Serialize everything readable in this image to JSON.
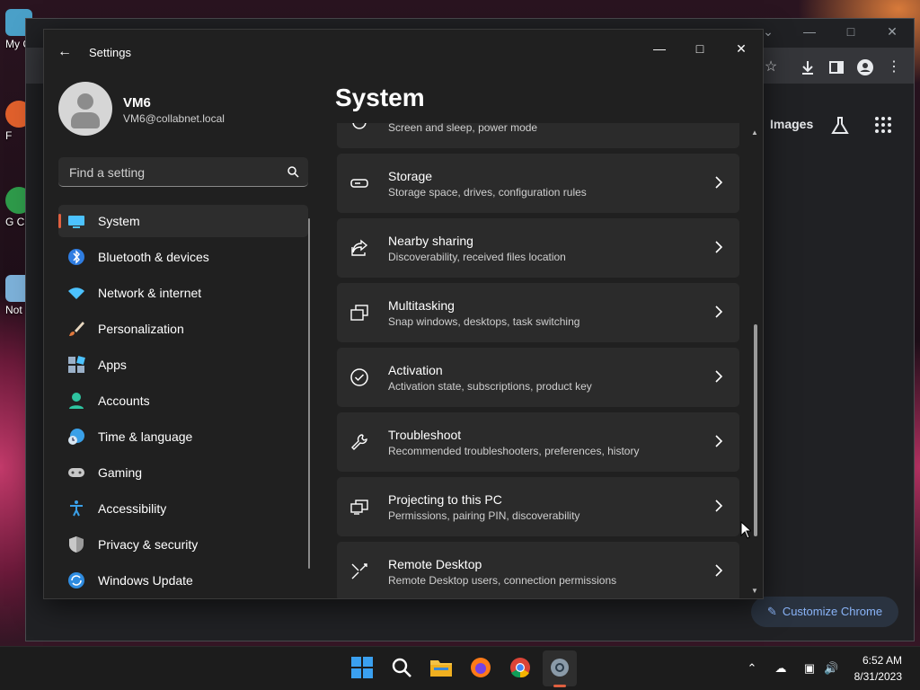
{
  "desktop": {
    "icons": [
      {
        "label": "My C"
      },
      {
        "label": "F"
      },
      {
        "label": "G Cl"
      },
      {
        "label": "Not"
      }
    ]
  },
  "chrome": {
    "images_label": "Images",
    "customize_label": "Customize Chrome"
  },
  "settings": {
    "window_title": "Settings",
    "user": {
      "name": "VM6",
      "email": "VM6@collabnet.local"
    },
    "search": {
      "placeholder": "Find a setting"
    },
    "nav": [
      {
        "label": "System",
        "icon": "system-icon",
        "active": true
      },
      {
        "label": "Bluetooth & devices",
        "icon": "bluetooth-icon"
      },
      {
        "label": "Network & internet",
        "icon": "wifi-icon"
      },
      {
        "label": "Personalization",
        "icon": "brush-icon"
      },
      {
        "label": "Apps",
        "icon": "apps-icon"
      },
      {
        "label": "Accounts",
        "icon": "account-icon"
      },
      {
        "label": "Time & language",
        "icon": "globe-clock-icon"
      },
      {
        "label": "Gaming",
        "icon": "gamepad-icon"
      },
      {
        "label": "Accessibility",
        "icon": "accessibility-icon"
      },
      {
        "label": "Privacy & security",
        "icon": "shield-icon"
      },
      {
        "label": "Windows Update",
        "icon": "update-icon"
      }
    ],
    "page_title": "System",
    "cards": [
      {
        "title": "",
        "subtitle": "Screen and sleep, power mode",
        "icon": "power-icon"
      },
      {
        "title": "Storage",
        "subtitle": "Storage space, drives, configuration rules",
        "icon": "storage-icon"
      },
      {
        "title": "Nearby sharing",
        "subtitle": "Discoverability, received files location",
        "icon": "share-icon"
      },
      {
        "title": "Multitasking",
        "subtitle": "Snap windows, desktops, task switching",
        "icon": "multitask-icon"
      },
      {
        "title": "Activation",
        "subtitle": "Activation state, subscriptions, product key",
        "icon": "check-circle-icon"
      },
      {
        "title": "Troubleshoot",
        "subtitle": "Recommended troubleshooters, preferences, history",
        "icon": "wrench-icon"
      },
      {
        "title": "Projecting to this PC",
        "subtitle": "Permissions, pairing PIN, discoverability",
        "icon": "project-icon"
      },
      {
        "title": "Remote Desktop",
        "subtitle": "Remote Desktop users, connection permissions",
        "icon": "remote-desktop-icon"
      }
    ]
  },
  "taskbar": {
    "apps": [
      "windows-start-icon",
      "search-icon",
      "file-explorer-icon",
      "firefox-icon",
      "chrome-icon",
      "settings-app-icon"
    ],
    "clock": {
      "time": "6:52 AM",
      "date": "8/31/2023"
    }
  },
  "colors": {
    "accent": "#e06040",
    "window_bg": "#202020",
    "card_bg": "#2b2b2b"
  }
}
